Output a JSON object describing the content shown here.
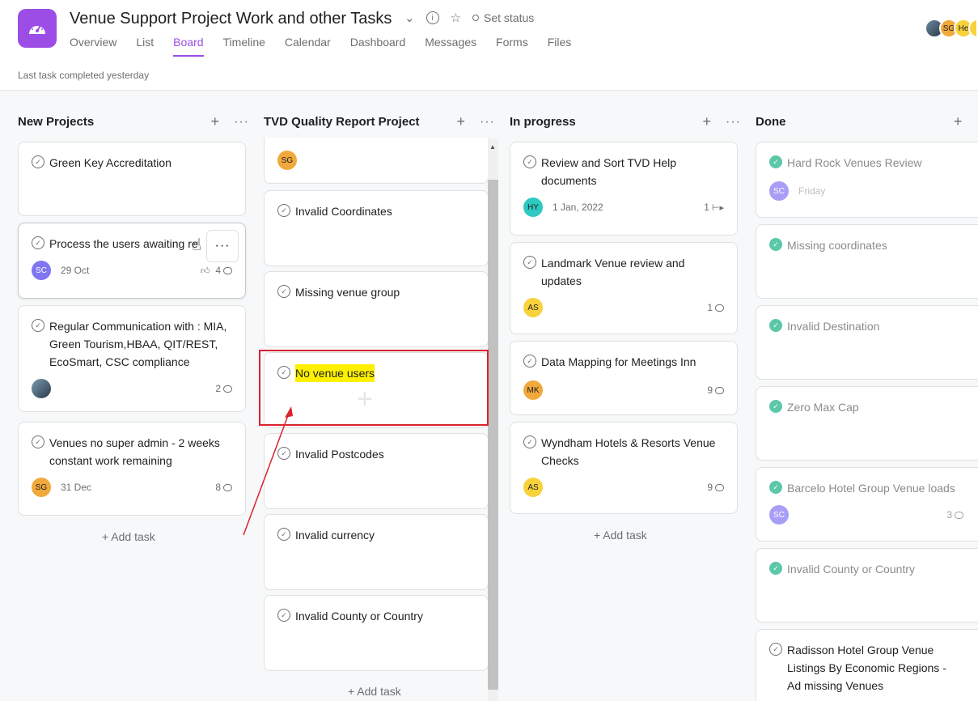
{
  "project": {
    "title": "Venue Support Project Work and other Tasks",
    "set_status": "Set status",
    "last_completed": "Last task completed yesterday",
    "brand_color": "#9c4de6"
  },
  "tabs": [
    "Overview",
    "List",
    "Board",
    "Timeline",
    "Calendar",
    "Dashboard",
    "Messages",
    "Forms",
    "Files"
  ],
  "active_tab": "Board",
  "members": [
    "SG",
    "He"
  ],
  "columns": [
    {
      "title": "New Projects",
      "add_task": "+ Add task",
      "cards": [
        {
          "name": "Green Key Accreditation"
        },
        {
          "name": "Process the users awaiting re",
          "avatar": "SC",
          "date": "29 Oct",
          "likes": "4"
        },
        {
          "name": "Regular Communication with : MIA, Green Tourism,HBAA, QIT/REST, EcoSmart, CSC compliance",
          "comments": "2"
        },
        {
          "name": "Venues no super admin - 2 weeks constant work remaining",
          "avatar": "SG",
          "date": "31 Dec",
          "comments": "8"
        }
      ]
    },
    {
      "title": "TVD Quality Report Project",
      "add_task": "+ Add task",
      "cards": [
        {
          "avatar": "SG"
        },
        {
          "name": "Invalid Coordinates"
        },
        {
          "name": "Missing venue group"
        },
        {
          "name": "No venue users"
        },
        {
          "name": "Invalid Postcodes"
        },
        {
          "name": "Invalid currency"
        },
        {
          "name": "Invalid County or Country"
        }
      ]
    },
    {
      "title": "In progress",
      "add_task": "+ Add task",
      "cards": [
        {
          "name": "Review and Sort TVD Help documents",
          "avatar": "HY",
          "date": "1 Jan, 2022",
          "subtasks": "1"
        },
        {
          "name": "Landmark Venue review and updates",
          "avatar": "AS",
          "comments": "1"
        },
        {
          "name": "Data Mapping for Meetings Inn",
          "avatar": "MK",
          "comments": "9"
        },
        {
          "name": "Wyndham Hotels & Resorts Venue Checks",
          "avatar": "AS",
          "comments": "9"
        }
      ]
    },
    {
      "title": "Done",
      "cards": [
        {
          "name": "Hard Rock Venues Review",
          "avatar": "SC",
          "date": "Friday"
        },
        {
          "name": "Missing coordinates"
        },
        {
          "name": "Invalid Destination"
        },
        {
          "name": "Zero Max Cap"
        },
        {
          "name": "Barcelo Hotel Group Venue loads",
          "avatar": "SC",
          "comments": "3"
        },
        {
          "name": "Invalid County or Country"
        },
        {
          "name": "Radisson Hotel Group Venue Listings By Economic Regions - Ad missing Venues"
        }
      ]
    }
  ],
  "avatar_colors": {
    "SC": "#7f77f1",
    "SG": "#f1a93c",
    "AS": "#f8d13b",
    "MK": "#f1a93c",
    "HY": "#2ec9c1",
    "He": "#f8d13b"
  }
}
